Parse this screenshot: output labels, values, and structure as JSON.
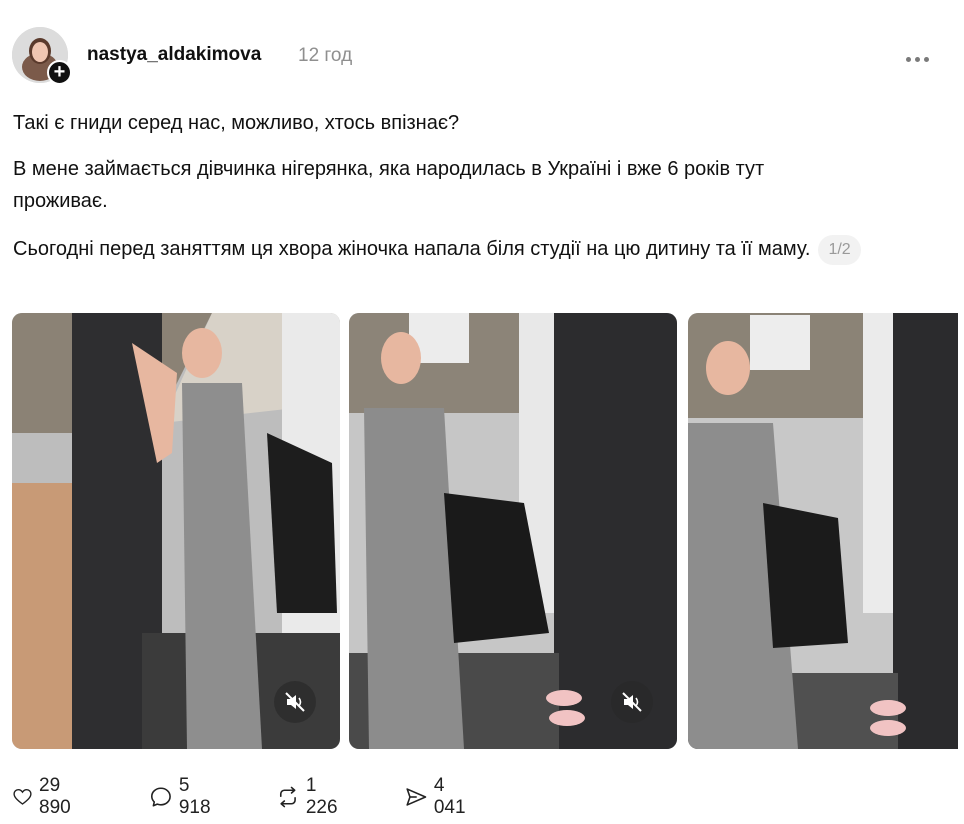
{
  "post": {
    "username": "nastya_aldakimova",
    "timestamp": "12 год",
    "paragraphs": {
      "p1": "Такі є гниди серед нас, можливо, хтось впізнає?",
      "p2": "В мене займається дівчинка нігерянка, яка народилась в Україні і вже 6 років тут проживає.",
      "p3": "Сьогодні перед заняттям ця хвора жіночка напала біля студії на цю дитину та її маму."
    },
    "page_indicator": "1/2",
    "media_count": 3
  },
  "actions": {
    "likes": "29 890",
    "comments": "5 918",
    "reposts": "1 226",
    "shares": "4 041"
  },
  "colors": {
    "text": "#101010",
    "muted": "#8f8f8f",
    "icon": "#222222"
  }
}
